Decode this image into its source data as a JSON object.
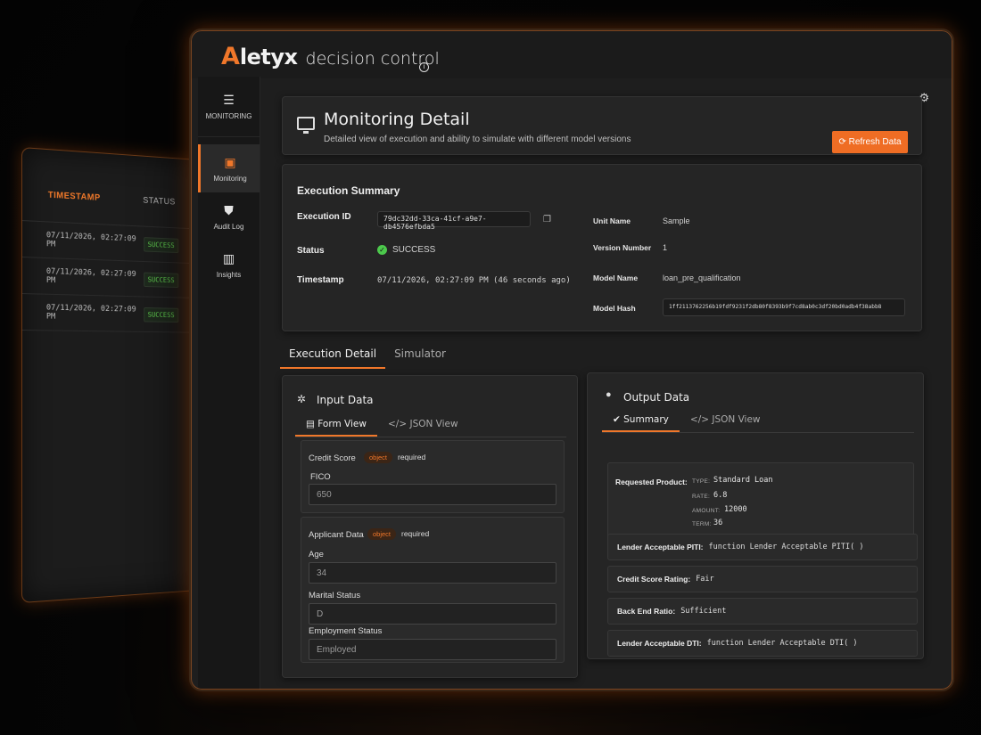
{
  "back_window": {
    "col_timestamp": "TIMESTAMP",
    "col_status": "STATUS",
    "rows": [
      {
        "timestamp": "07/11/2026, 02:27:09 PM",
        "status": "SUCCESS"
      },
      {
        "timestamp": "07/11/2026, 02:27:09 PM",
        "status": "SUCCESS"
      },
      {
        "timestamp": "07/11/2026, 02:27:09 PM",
        "status": "SUCCESS"
      }
    ]
  },
  "brand": {
    "mark": "A",
    "name": "letyx",
    "product": "decision control"
  },
  "sidebar": {
    "menu_label": "MONITORING",
    "items": [
      {
        "label": "Monitoring",
        "icon": "monitor-icon",
        "active": true
      },
      {
        "label": "Audit Log",
        "icon": "shield-icon",
        "active": false
      },
      {
        "label": "Insights",
        "icon": "bar-chart-icon",
        "active": false
      }
    ]
  },
  "header": {
    "title": "Monitoring Detail",
    "subtitle": "Detailed view of execution and ability to simulate with different model versions",
    "refresh_label": "Refresh Data"
  },
  "summary": {
    "title": "Execution Summary",
    "execution_id_label": "Execution ID",
    "execution_id": "79dc32dd-33ca-41cf-a9e7-db4576efbda5",
    "status_label": "Status",
    "status": "SUCCESS",
    "timestamp_label": "Timestamp",
    "timestamp": "07/11/2026, 02:27:09 PM (46 seconds ago)",
    "unit_name_label": "Unit Name",
    "unit_name": "Sample",
    "version_label": "Version Number",
    "version": "1",
    "model_name_label": "Model Name",
    "model_name": "loan_pre_qualification",
    "model_hash_label": "Model Hash",
    "model_hash": "1ff2113762256b19fdf9231f2db80f8393b9f7cd8ab0c3df20bd0adb4f38abb8"
  },
  "tabs": [
    "Execution Detail",
    "Simulator"
  ],
  "input": {
    "title": "Input Data",
    "subtabs": [
      "Form View",
      "JSON View"
    ],
    "credit_score": {
      "label": "Credit Score",
      "badge": "object",
      "required": "required",
      "fico_label": "FICO",
      "fico_value": "650"
    },
    "applicant": {
      "label": "Applicant Data",
      "badge": "object",
      "required": "required",
      "age_label": "Age",
      "age_value": "34",
      "marital_label": "Marital Status",
      "marital_value": "D",
      "employment_label": "Employment Status",
      "employment_value": "Employed"
    }
  },
  "output": {
    "title": "Output Data",
    "subtabs": [
      "Summary",
      "JSON View"
    ],
    "requested_product": {
      "label": "Requested Product:",
      "type_k": "TYPE:",
      "type_v": "Standard Loan",
      "rate_k": "RATE:",
      "rate_v": "6.8",
      "amount_k": "AMOUNT:",
      "amount_v": "12000",
      "term_k": "TERM:",
      "term_v": "36"
    },
    "rows": [
      {
        "k": "Lender Acceptable PITI:",
        "v": "function Lender Acceptable PITI( )"
      },
      {
        "k": "Credit Score Rating:",
        "v": "Fair"
      },
      {
        "k": "Back End Ratio:",
        "v": "Sufficient"
      },
      {
        "k": "Lender Acceptable DTI:",
        "v": "function Lender Acceptable DTI( )"
      }
    ]
  },
  "colors": {
    "accent": "#f0772a",
    "success": "#4cc94c"
  }
}
